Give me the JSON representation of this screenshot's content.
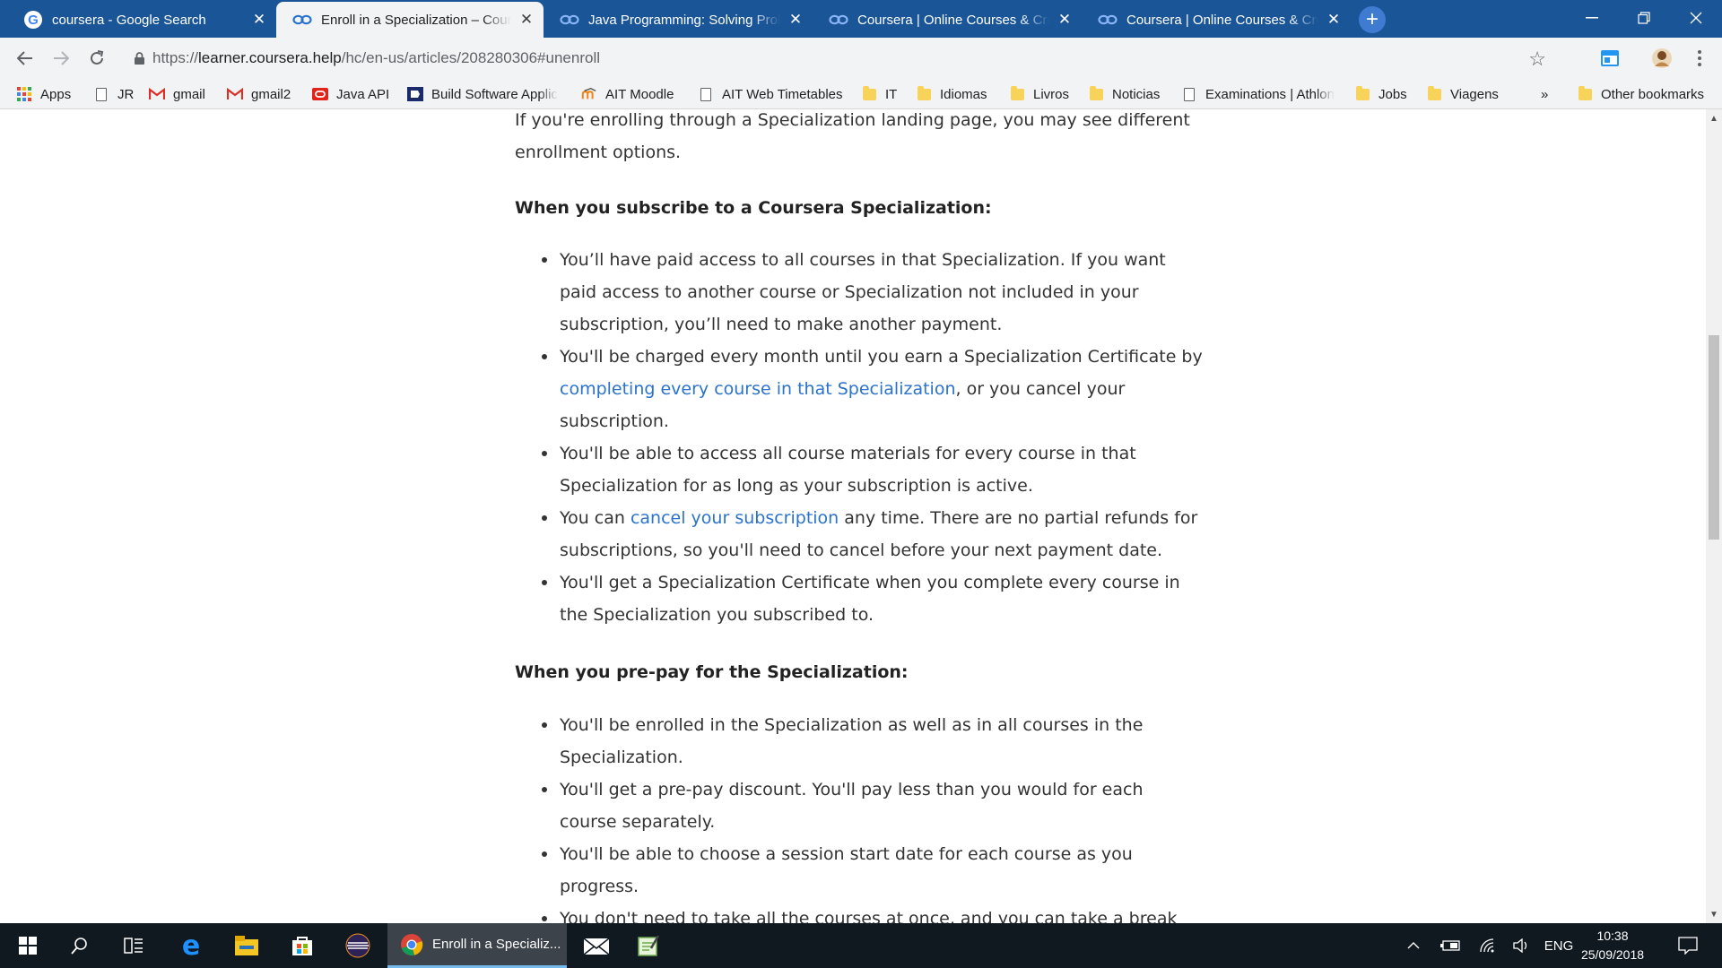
{
  "browser": {
    "tabs": [
      {
        "title": "coursera - Google Search",
        "icon": "google-icon",
        "active": false
      },
      {
        "title": "Enroll in a Specialization – Coursera",
        "icon": "coursera-icon",
        "active": true
      },
      {
        "title": "Java Programming: Solving Problems",
        "icon": "coursera-icon",
        "active": false
      },
      {
        "title": "Coursera | Online Courses & Credentials",
        "icon": "coursera-icon",
        "active": false
      },
      {
        "title": "Coursera | Online Courses & Credentials",
        "icon": "coursera-icon",
        "active": false
      }
    ],
    "url": {
      "scheme": "https://",
      "host": "learner.coursera.help",
      "path": "/hc/en-us/articles/208280306#unenroll"
    },
    "bookmarks": [
      {
        "label": "Apps",
        "icon": "apps-grid-icon"
      },
      {
        "label": "JR",
        "icon": "page-icon"
      },
      {
        "label": "gmail",
        "icon": "gmail-icon"
      },
      {
        "label": "gmail2",
        "icon": "gmail-icon"
      },
      {
        "label": "Java API",
        "icon": "oracle-icon"
      },
      {
        "label": "Build Software Applic",
        "icon": "build-icon"
      },
      {
        "label": "AIT Moodle",
        "icon": "moodle-icon"
      },
      {
        "label": "AIT Web Timetables",
        "icon": "page-icon"
      },
      {
        "label": "IT",
        "icon": "folder-icon"
      },
      {
        "label": "Idiomas",
        "icon": "folder-icon"
      },
      {
        "label": "Livros",
        "icon": "folder-icon"
      },
      {
        "label": "Noticias",
        "icon": "folder-icon"
      },
      {
        "label": "Examinations | Athlon",
        "icon": "page-icon"
      },
      {
        "label": "Jobs",
        "icon": "folder-icon"
      },
      {
        "label": "Viagens",
        "icon": "folder-icon"
      }
    ],
    "bookmarks_overflow": "»",
    "other_bookmarks": "Other bookmarks"
  },
  "article": {
    "intro_line1": "If you're enrolling through a Specialization landing page, you may see different",
    "intro_line2": "enrollment options.",
    "subscribe_heading": "When you subscribe to a Coursera Specialization:",
    "subscribe_items": {
      "b1": "You’ll have paid access to all courses in that Specialization. If you want paid access to another course or Specialization not included in your subscription, you’ll need to make another payment.",
      "b2_pre": "You'll be charged every month until you earn a Specialization Certificate by ",
      "b2_link": "completing every course in that Specialization",
      "b2_post": ", or you cancel your subscription.",
      "b3": "You'll be able to access all course materials for every course in that Specialization for as long as your subscription is active.",
      "b4_pre": "You can ",
      "b4_link": "cancel your subscription",
      "b4_post": " any time. There are no partial refunds for subscriptions, so you'll need to cancel before your next payment date.",
      "b5": "You'll get a Specialization Certificate when you complete every course in the Specialization you subscribed to."
    },
    "prepay_heading": "When you pre-pay for the Specialization:",
    "prepay_items": [
      "You'll be enrolled in the Specialization as well as in all courses in the Specialization.",
      "You'll get a pre-pay discount. You'll pay less than you would for each course separately.",
      "You'll be able to choose a session start date for each course as you progress.",
      "You don't need to take all the courses at once, and you can take a break"
    ]
  },
  "taskbar": {
    "active_app_label": "Enroll in a Specializ...",
    "language": "ENG",
    "time": "10:38",
    "date": "25/09/2018"
  },
  "colors": {
    "tabstrip": "#1a5597",
    "link": "#2a73cc",
    "taskbar": "#101820"
  }
}
